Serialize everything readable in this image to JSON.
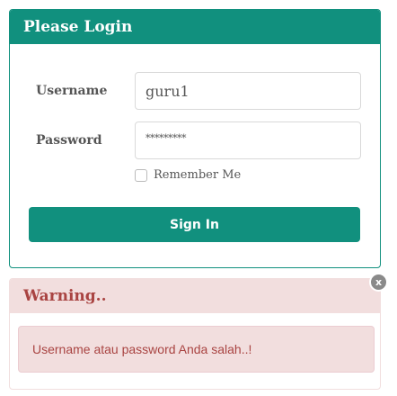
{
  "login": {
    "title": "Please Login",
    "username_label": "Username",
    "username_value": "guru1",
    "password_label": "Password",
    "password_value": "*********",
    "remember_label": "Remember Me",
    "sign_in_label": "Sign In"
  },
  "warning": {
    "title": "Warning..",
    "message": "Username atau password Anda salah..!",
    "close_label": "x"
  },
  "colors": {
    "primary": "#11907e",
    "warning_bg": "#f2dede",
    "warning_text": "#a94442"
  }
}
